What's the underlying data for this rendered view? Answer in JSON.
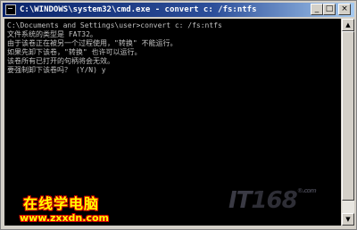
{
  "window": {
    "title": "C:\\WINDOWS\\system32\\cmd.exe - convert c: /fs:ntfs",
    "minimize_glyph": "_",
    "maximize_glyph": "□",
    "close_glyph": "×"
  },
  "console": {
    "lines": [
      "C:\\Documents and Settings\\user>convert c: /fs:ntfs",
      "文件系统的类型是 FAT32。",
      "由于该卷正在被另一个过程使用，\"转换\" 不能运行。",
      "如果先卸下该卷，\"转换\" 也许可以运行。",
      "该卷所有已打开的句柄将会无效。",
      "要强制卸下该卷吗？ (Y/N) y"
    ]
  },
  "scrollbar": {
    "up_glyph": "▲",
    "down_glyph": "▼"
  },
  "watermark": {
    "site_cn": "在线学电脑",
    "site_url": "www.zxxdn.com",
    "brand_it": "IT",
    "brand_num": "168",
    "brand_mark": "®",
    "brand_suffix": ".com"
  },
  "colors": {
    "console_bg": "#000000",
    "console_text": "#c0c0c0",
    "title_bar": "#0a246a"
  }
}
